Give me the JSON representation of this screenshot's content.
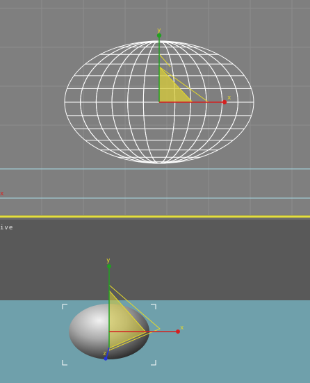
{
  "top_viewport": {
    "axis_x_label": "x",
    "axis_y_label": "y",
    "edge_axis_label": "x"
  },
  "bottom_viewport": {
    "label": "ive",
    "axis_x_label": "x",
    "axis_y_label": "y",
    "axis_z_label": "z"
  },
  "colors": {
    "wireframe": "#ffffff",
    "gizmo_yellow": "#e5d92a",
    "x_axis": "#d42020",
    "y_axis": "#22a022",
    "z_axis": "#2233dd",
    "ground": "#6fa0ab",
    "active_border": "#e4df3c"
  },
  "icons": [
    "move-gizmo-icon",
    "wireframe-sphere",
    "shaded-sphere",
    "selection-brackets"
  ]
}
